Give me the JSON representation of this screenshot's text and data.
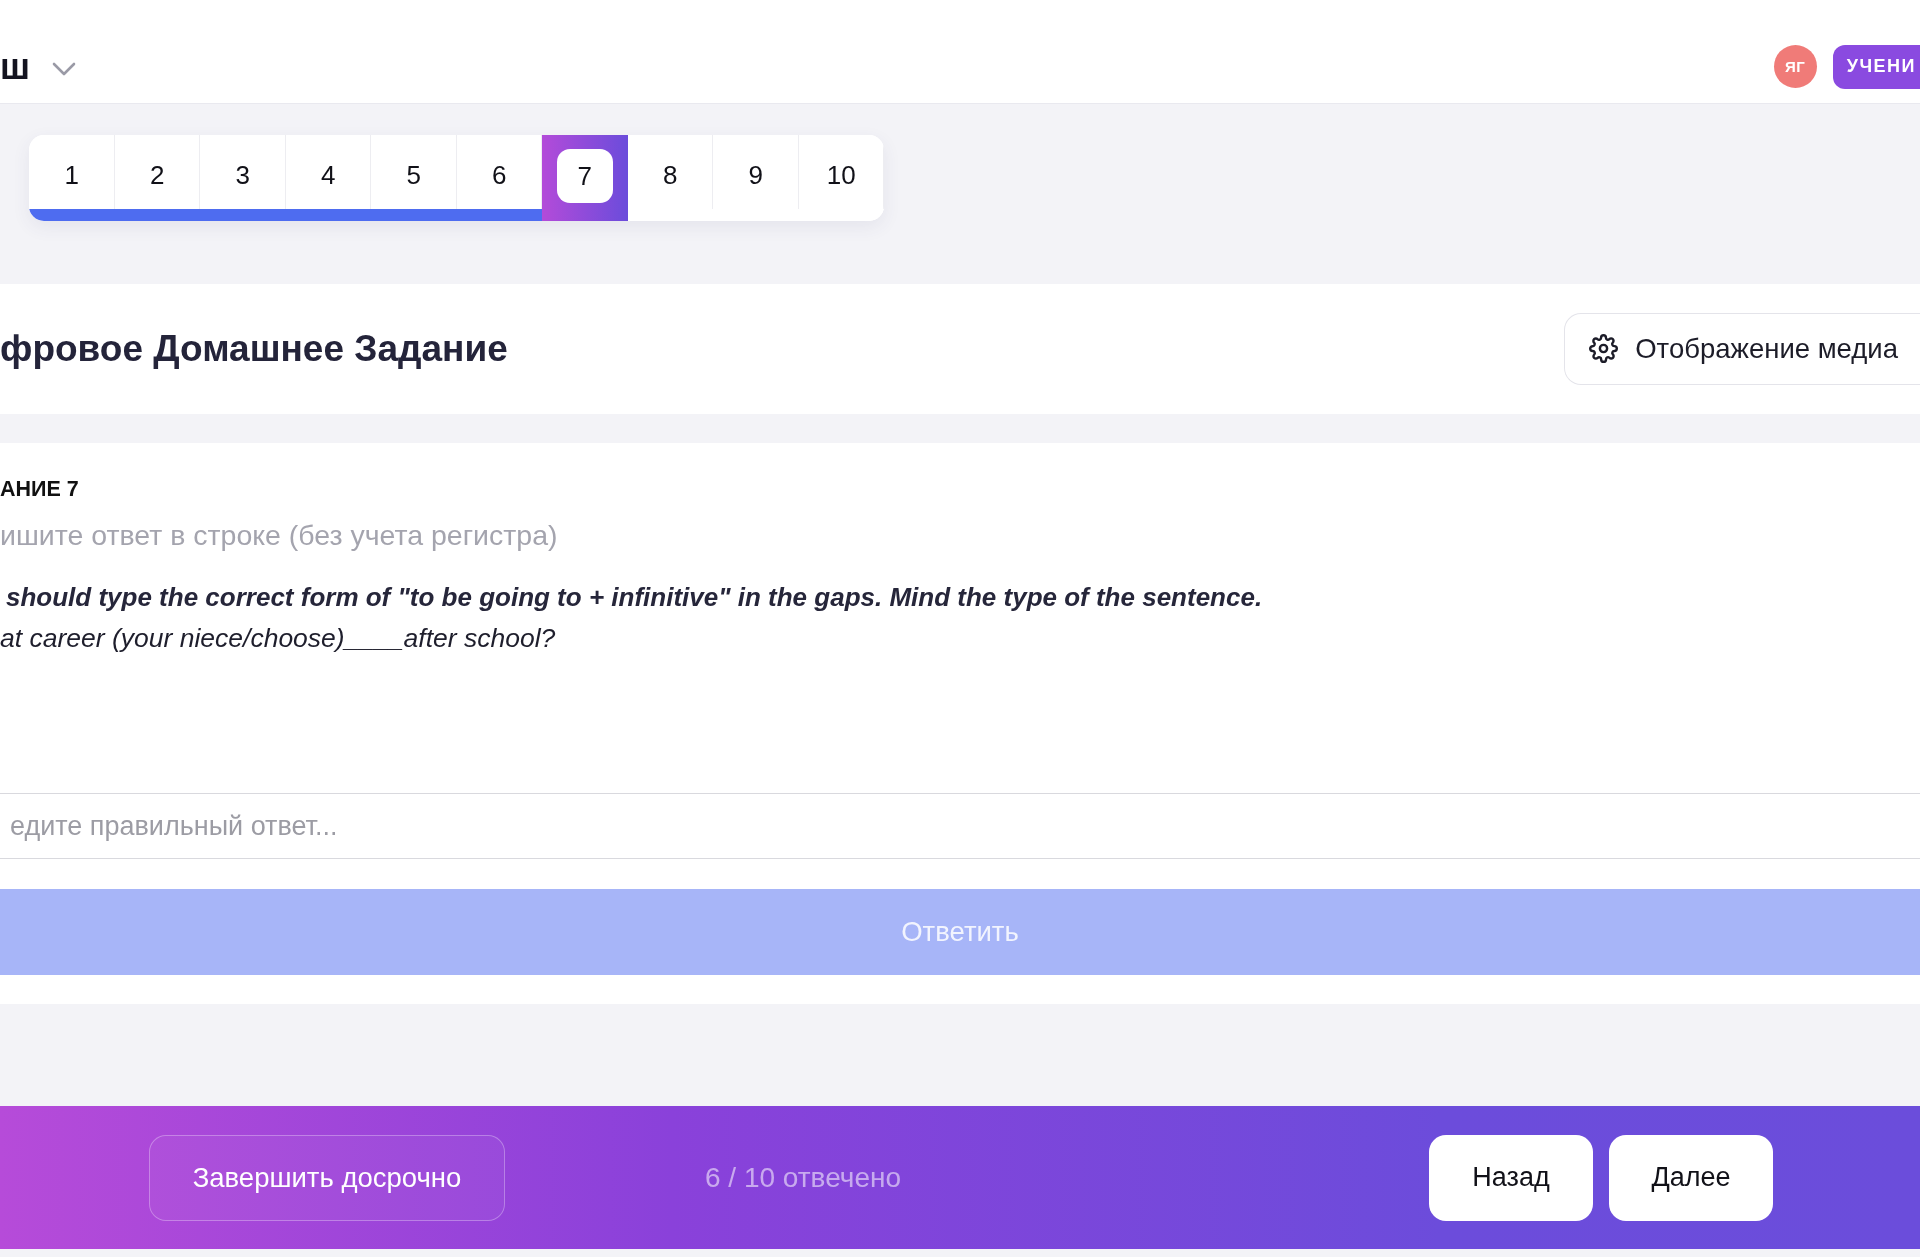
{
  "header": {
    "logo": "ш",
    "avatar": "ЯГ",
    "role_badge": "УЧЕНИ"
  },
  "question_tabs": [
    {
      "label": "1",
      "answered": true,
      "selected": false
    },
    {
      "label": "2",
      "answered": true,
      "selected": false
    },
    {
      "label": "3",
      "answered": true,
      "selected": false
    },
    {
      "label": "4",
      "answered": true,
      "selected": false
    },
    {
      "label": "5",
      "answered": true,
      "selected": false
    },
    {
      "label": "6",
      "answered": true,
      "selected": false
    },
    {
      "label": "7",
      "answered": false,
      "selected": true
    },
    {
      "label": "8",
      "answered": false,
      "selected": false
    },
    {
      "label": "9",
      "answered": false,
      "selected": false
    },
    {
      "label": "10",
      "answered": false,
      "selected": false
    }
  ],
  "title": "фровое Домашнее Задание",
  "media_button": {
    "label": "Отображение медиа"
  },
  "task": {
    "heading": "АНИЕ 7",
    "hint": "ишите ответ в строке (без учета регистра)",
    "instruction": "should type the correct form of \"to be going to + infinitive\" in the gaps. Mind the type of the sentence.",
    "sentence": "at career (your niece/choose)____after school?",
    "answer_field": {
      "placeholder": "едите правильный ответ..."
    },
    "submit_button": {
      "label": "Ответить",
      "disabled": true
    }
  },
  "footer": {
    "finish_button": "Завершить досрочно",
    "progress_text": "6 / 10 отвечено",
    "buttons": [
      "Назад",
      "Далее"
    ]
  }
}
